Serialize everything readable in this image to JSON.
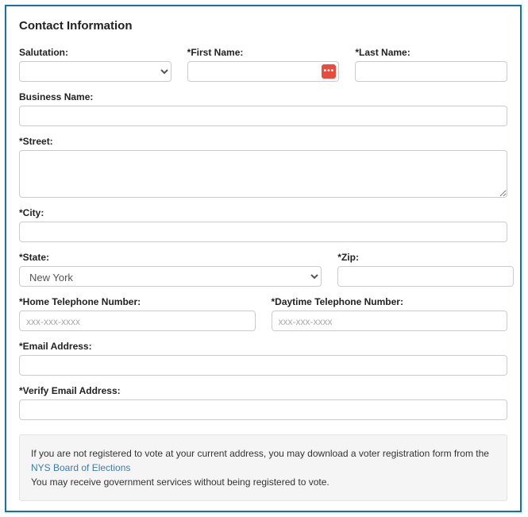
{
  "panel_title": "Contact Information",
  "fields": {
    "salutation": {
      "label": "Salutation:",
      "value": ""
    },
    "first_name": {
      "label": "*First Name:",
      "value": ""
    },
    "last_name": {
      "label": "*Last Name:",
      "value": ""
    },
    "business_name": {
      "label": "Business Name:",
      "value": ""
    },
    "street": {
      "label": "*Street:",
      "value": ""
    },
    "city": {
      "label": "*City:",
      "value": ""
    },
    "state": {
      "label": "*State:",
      "value": "New York"
    },
    "zip": {
      "label": "*Zip:",
      "value": ""
    },
    "home_phone": {
      "label": "*Home Telephone Number:",
      "value": "",
      "placeholder": "xxx-xxx-xxxx"
    },
    "day_phone": {
      "label": "*Daytime Telephone Number:",
      "value": "",
      "placeholder": "xxx-xxx-xxxx"
    },
    "email": {
      "label": "*Email Address:",
      "value": ""
    },
    "verify_email": {
      "label": "*Verify Email Address:",
      "value": ""
    }
  },
  "note": {
    "line1_a": "If you are not registered to vote at your current address, you may download a voter registration form from the ",
    "link_text": "NYS Board of Elections",
    "line2": "You may receive government services without being registered to vote."
  }
}
